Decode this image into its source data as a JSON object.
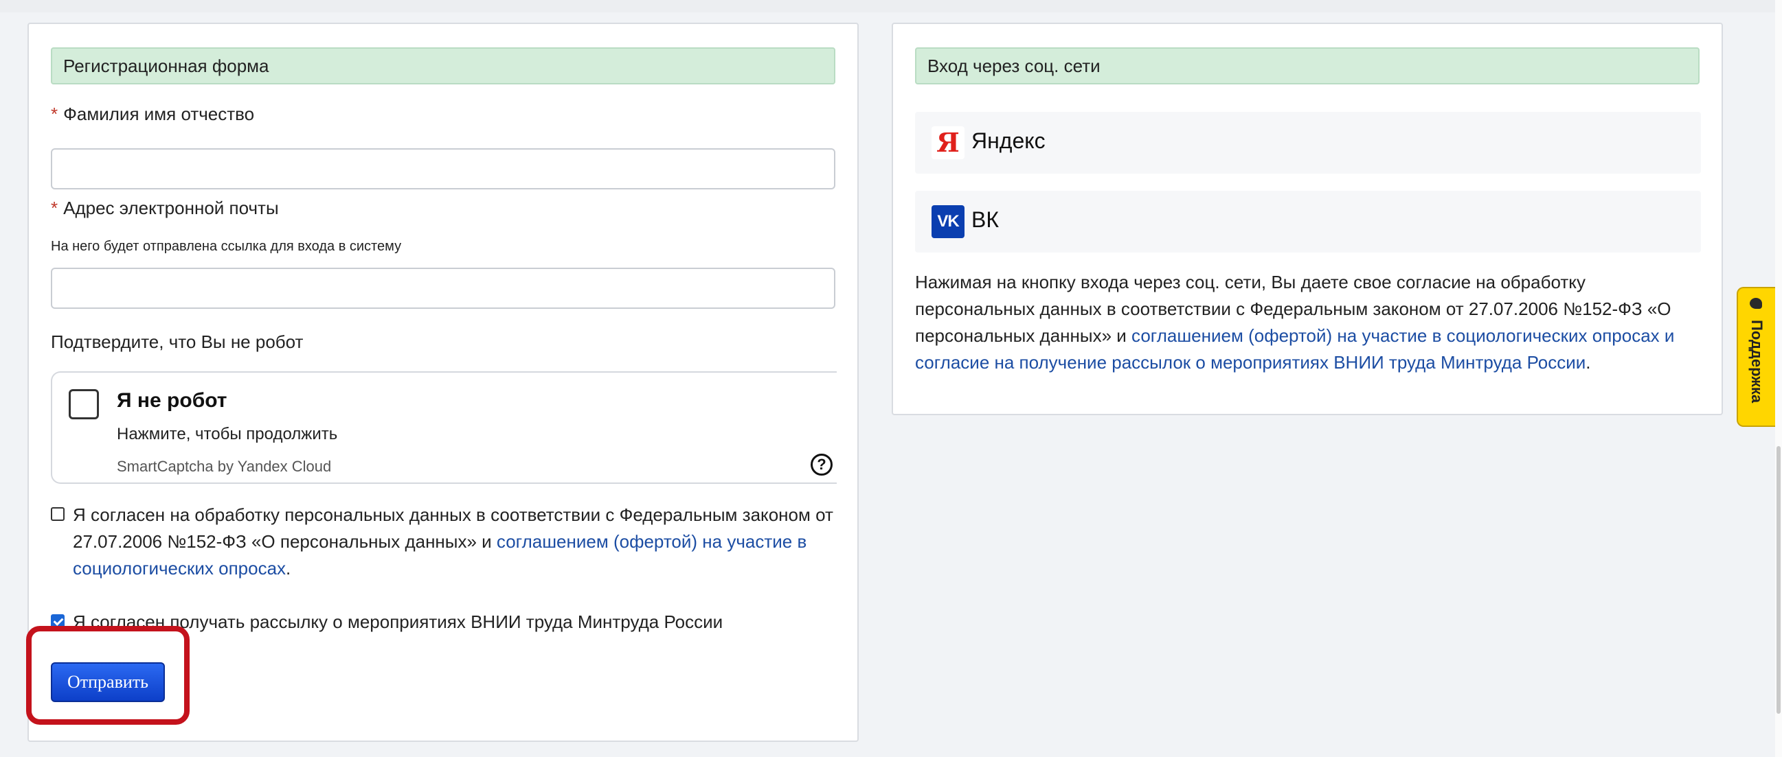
{
  "registration": {
    "header": "Регистрационная форма",
    "required_marker": "*",
    "full_name_label": "Фамилия имя отчество",
    "full_name_value": "",
    "email_label": "Адрес электронной почты",
    "email_hint": "На него будет отправлена ссылка для входа в систему",
    "email_value": "",
    "robot_prompt": "Подтвердите, что Вы не робот",
    "captcha": {
      "title": "Я не робот",
      "subtitle": "Нажмите, чтобы продолжить",
      "brand": "SmartCaptcha by Yandex Cloud",
      "help_icon": "?",
      "checked": false
    },
    "consent_personal": {
      "checked": false,
      "text": "Я согласен на обработку персональных данных в соответствии с Федеральным законом от 27.07.2006 №152-ФЗ «О персональных данных» и ",
      "link": "соглашением (офертой) на участие в социологических опросах",
      "tail": "."
    },
    "consent_newsletter": {
      "checked": true,
      "text": "Я согласен получать рассылку о мероприятиях ВНИИ труда Минтруда России"
    },
    "submit_label": "Отправить"
  },
  "social": {
    "header": "Вход через соц. сети",
    "yandex": {
      "logo": "Я",
      "label": "Яндекс",
      "icon": "yandex-logo-icon"
    },
    "vk": {
      "logo": "VK",
      "label": "ВК",
      "icon": "vk-logo-icon"
    },
    "consent_text": "Нажимая на кнопку входа через соц. сети, Вы даете свое согласие на обработку персональных данных в соответствии с Федеральным законом от 27.07.2006 №152-ФЗ «О персональных данных» и ",
    "consent_link": "соглашением (офертой) на участие в социологических опросах и согласие на получение рассылок о мероприятиях ВНИИ труда Минтруда России",
    "consent_tail": "."
  },
  "support_tab": {
    "label": "Поддержка",
    "icon": "chat-icon"
  },
  "colors": {
    "header_bg": "#d4edda",
    "link": "#1c4da3",
    "submit_button": "#1a4fe0",
    "highlight": "#c4121c",
    "support_tab": "#ffd600"
  }
}
